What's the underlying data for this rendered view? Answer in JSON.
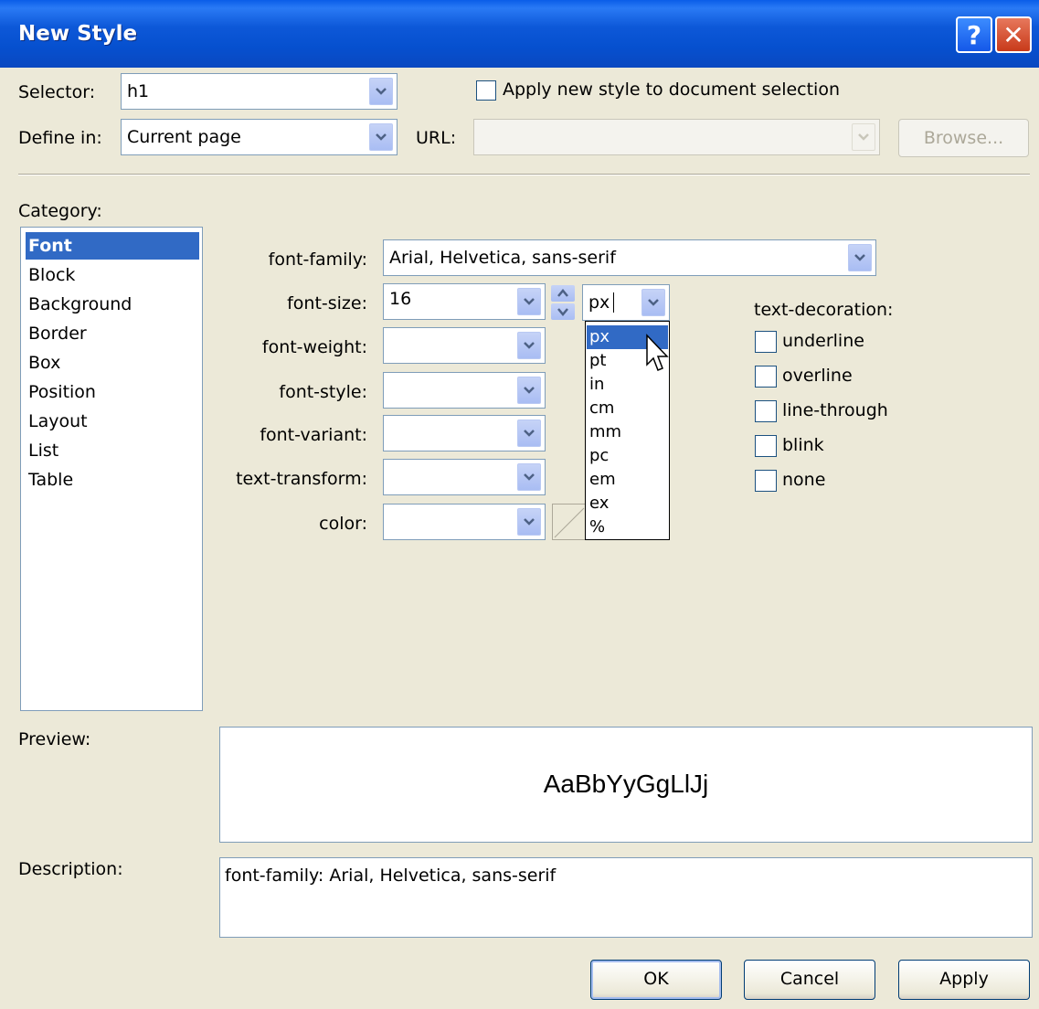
{
  "window": {
    "title": "New Style",
    "help": "?",
    "close": "✕"
  },
  "selector": {
    "label": "Selector:",
    "value": "h1"
  },
  "apply_selection": {
    "label": "Apply new style to document selection"
  },
  "define_in": {
    "label": "Define in:",
    "value": "Current page"
  },
  "url": {
    "label": "URL:",
    "value": ""
  },
  "browse": {
    "label": "Browse..."
  },
  "category": {
    "label": "Category:",
    "items": [
      "Font",
      "Block",
      "Background",
      "Border",
      "Box",
      "Position",
      "Layout",
      "List",
      "Table"
    ],
    "selected": "Font"
  },
  "font": {
    "family_label": "font-family:",
    "family_value": "Arial, Helvetica, sans-serif",
    "size_label": "font-size:",
    "size_value": "16",
    "unit_value": "px",
    "weight_label": "font-weight:",
    "weight_value": "",
    "style_label": "font-style:",
    "style_value": "",
    "variant_label": "font-variant:",
    "variant_value": "",
    "transform_label": "text-transform:",
    "transform_value": "",
    "color_label": "color:",
    "color_value": ""
  },
  "unit_options": [
    "px",
    "pt",
    "in",
    "cm",
    "mm",
    "pc",
    "em",
    "ex",
    "%"
  ],
  "unit_highlighted": "px",
  "decoration": {
    "label": "text-decoration:",
    "options": [
      "underline",
      "overline",
      "line-through",
      "blink",
      "none"
    ]
  },
  "preview": {
    "label": "Preview:",
    "sample": "AaBbYyGgLlJj"
  },
  "description": {
    "label": "Description:",
    "text": "font-family: Arial, Helvetica, sans-serif"
  },
  "buttons": {
    "ok": "OK",
    "cancel": "Cancel",
    "apply": "Apply"
  },
  "colors": {
    "title_blue": "#0a5de8",
    "selection": "#316ac5",
    "dialog_bg": "#ece9d8",
    "field_border": "#7f9db9"
  }
}
